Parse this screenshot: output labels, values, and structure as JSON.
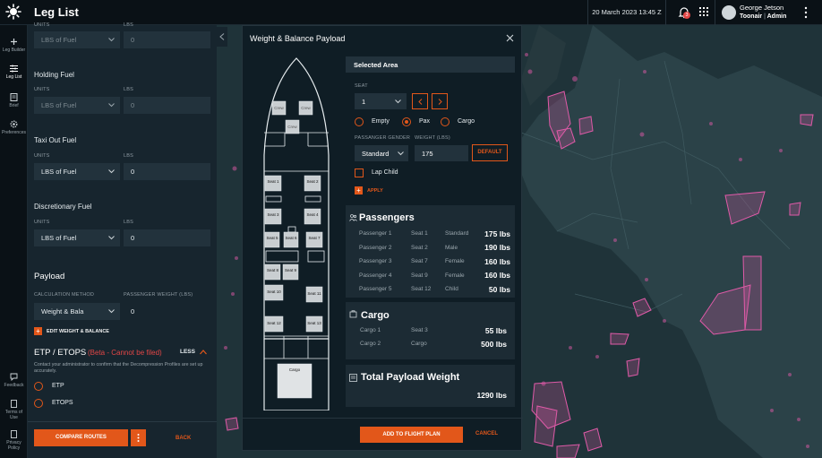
{
  "app": {
    "title": "Leg List",
    "date": "20 March 2023 13:45 Z",
    "notifications": "3",
    "user_name": "George Jetson",
    "user_org": "Toonair",
    "user_role": "Admin"
  },
  "colors": {
    "accent": "#e2571a",
    "panel": "#17252e",
    "map_zone": "#e05aa8",
    "danger": "#e24646"
  },
  "nav": [
    {
      "icon": "plus-icon",
      "label": "Leg Builder"
    },
    {
      "icon": "list-icon",
      "label": "Leg List"
    },
    {
      "icon": "document-icon",
      "label": "Brief"
    },
    {
      "icon": "gear-icon",
      "label": "Preferences"
    }
  ],
  "nav_bottom": [
    {
      "icon": "feedback-icon",
      "label": "Feedback"
    },
    {
      "icon": "terms-icon",
      "label": "Terms of Use"
    },
    {
      "icon": "privacy-icon",
      "label": "Privacy Policy"
    }
  ],
  "fuel": {
    "top": {
      "units_label": "UNITS",
      "lbs_label": "LBS",
      "units": "LBS of Fuel",
      "lbs": "0"
    },
    "holding": {
      "title": "Holding Fuel",
      "units_label": "UNITS",
      "lbs_label": "LBS",
      "units": "LBS of Fuel",
      "lbs": "0"
    },
    "taxi": {
      "title": "Taxi Out Fuel",
      "units_label": "UNITS",
      "lbs_label": "LBS",
      "units": "LBS of Fuel",
      "lbs": "0"
    },
    "discretionary": {
      "title": "Discretionary Fuel",
      "units_label": "UNITS",
      "lbs_label": "LBS",
      "units": "LBS of Fuel",
      "lbs": "0"
    }
  },
  "payload": {
    "title": "Payload",
    "method_label": "CALCULATION METHOD",
    "weight_label": "PASSENGER WEIGHT (LBS)",
    "method": "Weight & Bala",
    "weight": "0",
    "edit_link": "EDIT WEIGHT & BALANCE"
  },
  "etops": {
    "title": "ETP / ETOPS",
    "beta": "(Beta - Cannot be filed)",
    "less": "LESS",
    "note": "Contact your administrator to confirm that the Decompression Profiles are set up accurately.",
    "options": [
      "ETP",
      "ETOPS"
    ]
  },
  "footer": {
    "compare": "COMPARE ROUTES",
    "back": "BACK"
  },
  "modal": {
    "title": "Weight & Balance Payload",
    "selected_area": "Selected Area",
    "seat_label": "SEAT",
    "seat_value": "1",
    "types": [
      "Empty",
      "Pax",
      "Cargo"
    ],
    "selected_type": "Pax",
    "gender_label": "PASSANGER GENDER",
    "weight_label": "WEIGHT (LBS)",
    "gender": "Standard",
    "weight": "175",
    "default_btn": "DEFAULT",
    "lap_child": "Lap Child",
    "apply": "APPLY",
    "add_btn": "ADD TO FLIGHT PLAN",
    "cancel_btn": "CANCEL"
  },
  "seatmap": {
    "crew": [
      "Crew",
      "Crew",
      "Crew"
    ],
    "seats": [
      "Seat 1",
      "Seat 2",
      "Seat 3",
      "Seat 4",
      "Seat 5",
      "Seat 6",
      "Seat 7",
      "Seat 8",
      "Seat 9",
      "Seat 10",
      "Seat 11",
      "Seat 12",
      "Seat 13"
    ],
    "cargo": "Cargo"
  },
  "passengers": {
    "title": "Passengers",
    "rows": [
      {
        "name": "Passenger 1",
        "seat": "Seat 1",
        "type": "Standard",
        "weight": "175 lbs"
      },
      {
        "name": "Passenger 2",
        "seat": "Seat 2",
        "type": "Male",
        "weight": "190 lbs"
      },
      {
        "name": "Passenger 3",
        "seat": "Seat 7",
        "type": "Female",
        "weight": "160 lbs"
      },
      {
        "name": "Passenger 4",
        "seat": "Seat 9",
        "type": "Female",
        "weight": "160 lbs"
      },
      {
        "name": "Passenger 5",
        "seat": "Seat 12",
        "type": "Child",
        "weight": "50 lbs"
      }
    ]
  },
  "cargo": {
    "title": "Cargo",
    "rows": [
      {
        "name": "Cargo 1",
        "area": "Seat 3",
        "weight": "55 lbs"
      },
      {
        "name": "Cargo  2",
        "area": "Cargo",
        "weight": "500 lbs"
      }
    ]
  },
  "total": {
    "title": "Total Payload Weight",
    "value": "1290 lbs"
  }
}
